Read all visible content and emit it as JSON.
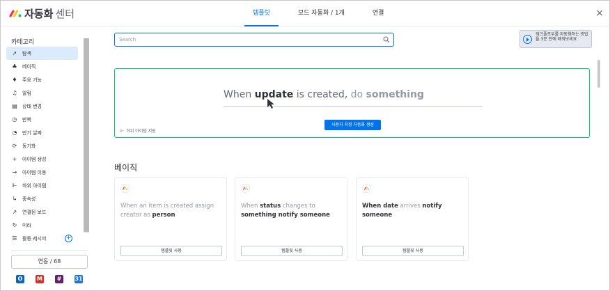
{
  "header": {
    "title_bold": "자동화",
    "title_rest": "센터",
    "tabs": [
      {
        "label": "템플릿",
        "active": true
      },
      {
        "label": "보드 자동화 / 1개",
        "active": false
      },
      {
        "label": "연결",
        "active": false
      }
    ],
    "close": "×"
  },
  "sidebar": {
    "title": "카테고리",
    "items": [
      {
        "label": "탐색",
        "icon": "rocket-icon",
        "glyph": "➚",
        "active": true
      },
      {
        "label": "베이직",
        "icon": "shapes-icon",
        "glyph": "♣"
      },
      {
        "label": "주요 기능",
        "icon": "gem-icon",
        "glyph": "♦"
      },
      {
        "label": "알림",
        "icon": "bell-icon",
        "glyph": "♫"
      },
      {
        "label": "상태 변경",
        "icon": "status-icon",
        "glyph": "▤"
      },
      {
        "label": "반복",
        "icon": "clock-icon",
        "glyph": "◷"
      },
      {
        "label": "만기 날짜",
        "icon": "calendar-icon",
        "glyph": "◔"
      },
      {
        "label": "동기화",
        "icon": "sync-icon",
        "glyph": "⟳"
      },
      {
        "label": "아이템 생성",
        "icon": "plus-icon",
        "glyph": "+"
      },
      {
        "label": "아이템 이동",
        "icon": "arrow-right-icon",
        "glyph": "→"
      },
      {
        "label": "하위 아이템",
        "icon": "subitem-icon",
        "glyph": "⊩"
      },
      {
        "label": "종속성",
        "icon": "dependency-icon",
        "glyph": "↳"
      },
      {
        "label": "연결된 보드",
        "icon": "link-arrow-icon",
        "glyph": "↗"
      },
      {
        "label": "미러",
        "icon": "mirror-icon",
        "glyph": "↻"
      },
      {
        "label": "활동 레시피",
        "icon": "recipe-icon",
        "glyph": "☰"
      }
    ],
    "integration_button": "연동 / 68",
    "apps": [
      {
        "name": "outlook-icon",
        "letter": "O",
        "color": "#0a64c7"
      },
      {
        "name": "gmail-icon",
        "letter": "M",
        "color": "#d93025"
      },
      {
        "name": "slack-icon",
        "letter": "#",
        "color": "#611f69"
      },
      {
        "name": "calendar-app-icon",
        "letter": "31",
        "color": "#1a73e8"
      }
    ]
  },
  "search": {
    "placeholder": "Search"
  },
  "video": {
    "text": "워크플로우를 자동화하는 방법을 3분 안에 배워보세요"
  },
  "builder": {
    "part1": "When ",
    "part2": "update",
    "part3": " is created, ",
    "part4": "do ",
    "part5": "something",
    "button": "사용자 지정 자동화 생성",
    "subitems_label": "하위 아이템 지원"
  },
  "section_title": "베이직",
  "cards": [
    {
      "t1": "When an item is created assign creator as ",
      "b1": "person",
      "button": "템플릿 사용"
    },
    {
      "t1": "When ",
      "b1": "status",
      "t2": " changes to ",
      "b2": "something notify someone",
      "button": "템플릿 사용"
    },
    {
      "b0": "When date",
      "t1": " arrives ",
      "b1": "notify someone",
      "button": "템플릿 사용"
    }
  ],
  "colors": {
    "accent": "#0073ea",
    "builder_border": "#00c875",
    "active_item_bg": "#dcebfb"
  }
}
